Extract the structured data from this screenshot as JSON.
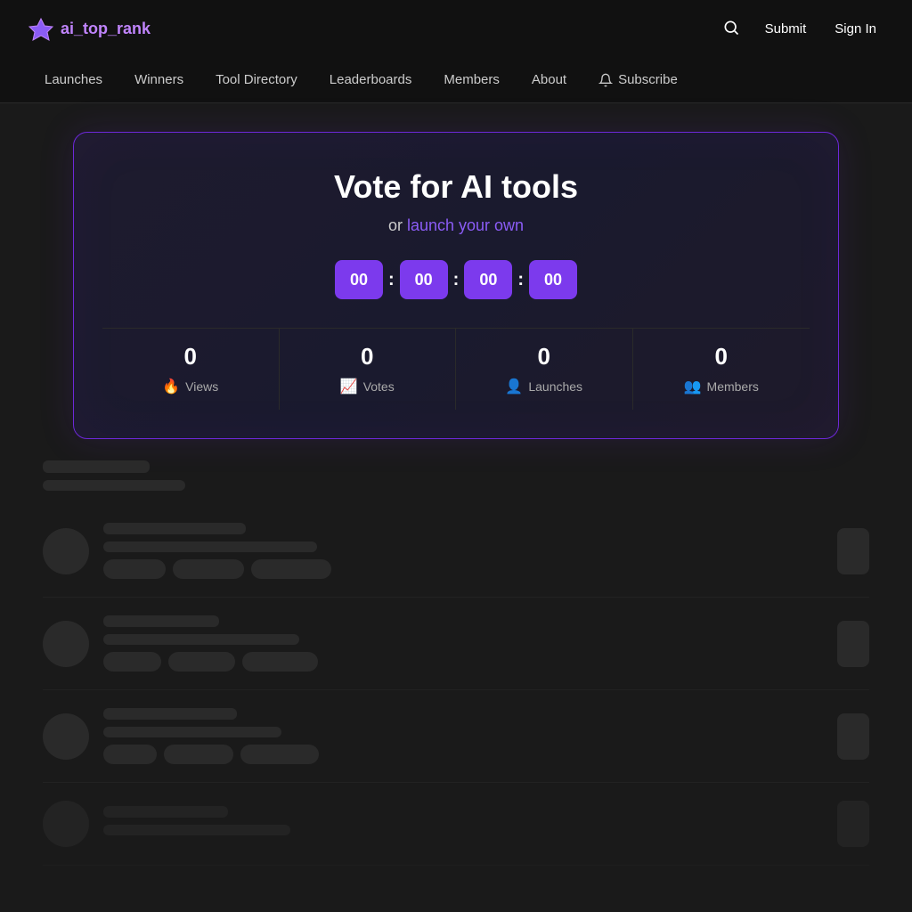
{
  "header": {
    "logo_text": "ai_top_rank",
    "submit_label": "Submit",
    "signin_label": "Sign In"
  },
  "nav": {
    "items": [
      {
        "label": "Launches",
        "id": "launches"
      },
      {
        "label": "Winners",
        "id": "winners"
      },
      {
        "label": "Tool Directory",
        "id": "tool-directory"
      },
      {
        "label": "Leaderboards",
        "id": "leaderboards"
      },
      {
        "label": "Members",
        "id": "members"
      },
      {
        "label": "About",
        "id": "about"
      },
      {
        "label": "Subscribe",
        "id": "subscribe"
      }
    ]
  },
  "hero": {
    "title": "Vote for AI tools",
    "subtitle_prefix": "or ",
    "subtitle_link": "launch your own",
    "countdown": {
      "blocks": [
        "00",
        "00",
        "00",
        "00"
      ],
      "separators": [
        ":",
        ":",
        ":"
      ]
    },
    "stats": [
      {
        "number": "0",
        "label": "Views",
        "icon": "🔥"
      },
      {
        "number": "0",
        "label": "Votes",
        "icon": "📈"
      },
      {
        "number": "0",
        "label": "Launches",
        "icon": "👤"
      },
      {
        "number": "0",
        "label": "Members",
        "icon": "👥"
      }
    ]
  },
  "list": {
    "skeleton_items": [
      1,
      2,
      3,
      4
    ]
  }
}
